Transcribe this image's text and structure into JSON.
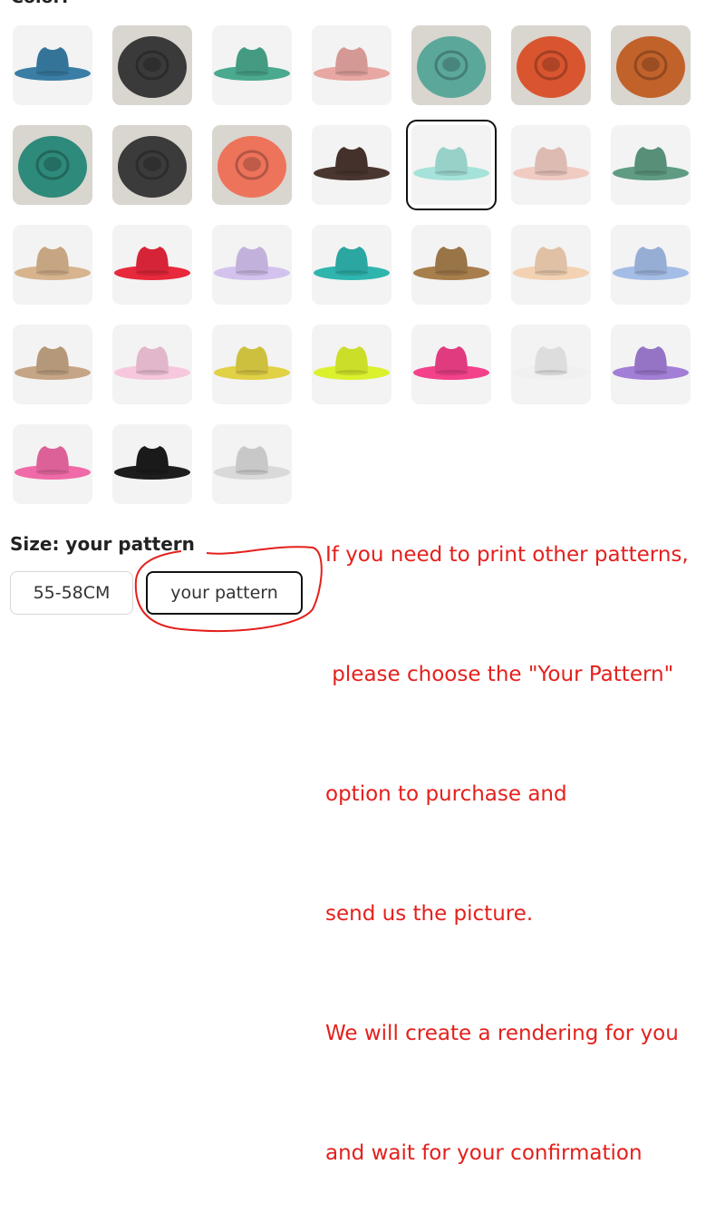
{
  "color_label": "Color: ",
  "swatches": [
    {
      "name": "blue",
      "hat": "#3a7ea6",
      "photo": false
    },
    {
      "name": "grey-top",
      "hat": "#3a3a3a",
      "photo": true
    },
    {
      "name": "pattern-green",
      "hat": "#4aa98e",
      "photo": false
    },
    {
      "name": "pattern-pink",
      "hat": "#e8a7a2",
      "photo": false
    },
    {
      "name": "teal-photo",
      "hat": "#5ba89a",
      "photo": true
    },
    {
      "name": "orange-photo",
      "hat": "#d9552f",
      "photo": true
    },
    {
      "name": "rust-photo",
      "hat": "#c2622b",
      "photo": true
    },
    {
      "name": "dark-teal-photo",
      "hat": "#2e8a7a",
      "photo": true
    },
    {
      "name": "charcoal-photo",
      "hat": "#3b3b3b",
      "photo": true
    },
    {
      "name": "coral-photo",
      "hat": "#ee735b",
      "photo": true
    },
    {
      "name": "brown",
      "hat": "#4a3630",
      "photo": false
    },
    {
      "name": "mint",
      "hat": "#a5e3da",
      "photo": false
    },
    {
      "name": "blush",
      "hat": "#f0cbc2",
      "photo": false
    },
    {
      "name": "sage-green",
      "hat": "#5f9c83",
      "photo": false
    },
    {
      "name": "tan",
      "hat": "#d7b48e",
      "photo": false
    },
    {
      "name": "red",
      "hat": "#e8283c",
      "photo": false
    },
    {
      "name": "lavender",
      "hat": "#d3c2ee",
      "photo": false
    },
    {
      "name": "turquoise",
      "hat": "#2fb5ae",
      "photo": false
    },
    {
      "name": "camel",
      "hat": "#a77e4c",
      "photo": false
    },
    {
      "name": "peach",
      "hat": "#f3d2b3",
      "photo": false
    },
    {
      "name": "periwinkle",
      "hat": "#a3bde6",
      "photo": false
    },
    {
      "name": "khaki",
      "hat": "#c5a585",
      "photo": false
    },
    {
      "name": "light-pink",
      "hat": "#f6c7dd",
      "photo": false
    },
    {
      "name": "mustard",
      "hat": "#e0d145",
      "photo": false
    },
    {
      "name": "neon-yellow",
      "hat": "#dcf12e",
      "photo": false
    },
    {
      "name": "hot-pink",
      "hat": "#f3418a",
      "photo": false
    },
    {
      "name": "white",
      "hat": "#f0f0f0",
      "photo": false
    },
    {
      "name": "purple",
      "hat": "#a27ed6",
      "photo": false
    },
    {
      "name": "bubblegum",
      "hat": "#f06aa7",
      "photo": false
    },
    {
      "name": "black",
      "hat": "#1d1d1d",
      "photo": false
    },
    {
      "name": "light-grey",
      "hat": "#d9d9d9",
      "photo": false
    }
  ],
  "selected_swatch": 11,
  "size": {
    "label": "Size: your pattern",
    "options": [
      "55-58CM",
      "your pattern"
    ],
    "selected": 1
  },
  "note_lines": [
    "If you need to print other patterns,",
    " please choose the \"Your Pattern\"",
    "option to purchase and",
    "send us the picture.",
    "We will create a rendering for you",
    "and wait for your confirmation"
  ],
  "colors": {
    "accent_red": "#e4201c",
    "border": "#111111"
  }
}
